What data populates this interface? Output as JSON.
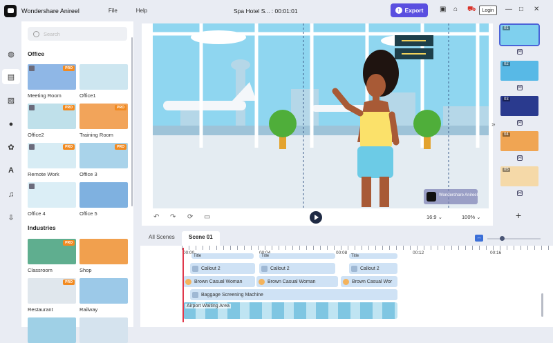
{
  "app": {
    "name": "Wondershare Anireel",
    "menu": [
      "File",
      "Help"
    ],
    "doc_title": "Spa Hotel S... : 00:01:01"
  },
  "toolbar": {
    "export_label": "Export",
    "login_label": "Login"
  },
  "library": {
    "search_placeholder": "Search",
    "sections": [
      {
        "title": "Office",
        "items": [
          {
            "label": "Meeting Room",
            "pro": true,
            "color": "#8fb7e6"
          },
          {
            "label": "Office1",
            "pro": false,
            "color": "#cde6f0"
          },
          {
            "label": "Office2",
            "pro": true,
            "color": "#bfe0ea"
          },
          {
            "label": "Training Room",
            "pro": true,
            "color": "#f2a45a"
          },
          {
            "label": "Remote Work",
            "pro": true,
            "color": "#d7ecf4"
          },
          {
            "label": "Office 3",
            "pro": true,
            "color": "#a9d3ea"
          },
          {
            "label": "Office 4",
            "pro": false,
            "color": "#dbeef6"
          },
          {
            "label": "Office 5",
            "pro": false,
            "color": "#7fb1e0"
          }
        ]
      },
      {
        "title": "Industries",
        "items": [
          {
            "label": "Classroom",
            "pro": true,
            "color": "#5fae8f"
          },
          {
            "label": "Shop",
            "pro": false,
            "color": "#f1a04e"
          },
          {
            "label": "Restaurant",
            "pro": true,
            "color": "#e0e7ed"
          },
          {
            "label": "Railway",
            "pro": false,
            "color": "#9cc9e8"
          },
          {
            "label": "",
            "pro": false,
            "color": "#9fd0e6"
          },
          {
            "label": "",
            "pro": false,
            "color": "#d5e3ee"
          }
        ]
      }
    ]
  },
  "preview": {
    "ratio": "16:9",
    "zoom": "100%",
    "watermark": "Wondershare Anireel"
  },
  "scenes": [
    {
      "num": "01",
      "color": "#7fd0ee"
    },
    {
      "num": "02",
      "color": "#58b9e6"
    },
    {
      "num": "03",
      "color": "#2a3a8e"
    },
    {
      "num": "04",
      "color": "#f0a553"
    },
    {
      "num": "05",
      "color": "#f5d9a8"
    }
  ],
  "timeline": {
    "tabs": [
      "All Scenes",
      "Scene 01"
    ],
    "ticks": [
      "00:00",
      "00:04",
      "00:08",
      "00:12",
      "00:16"
    ],
    "tracks": {
      "title": "Title",
      "callout": "Callout 2",
      "character": "Brown Casual Woman",
      "character_cut": "Brown Casual Wor",
      "object": "Baggage Screening Machine",
      "background": "Airport Waiting Area"
    }
  }
}
